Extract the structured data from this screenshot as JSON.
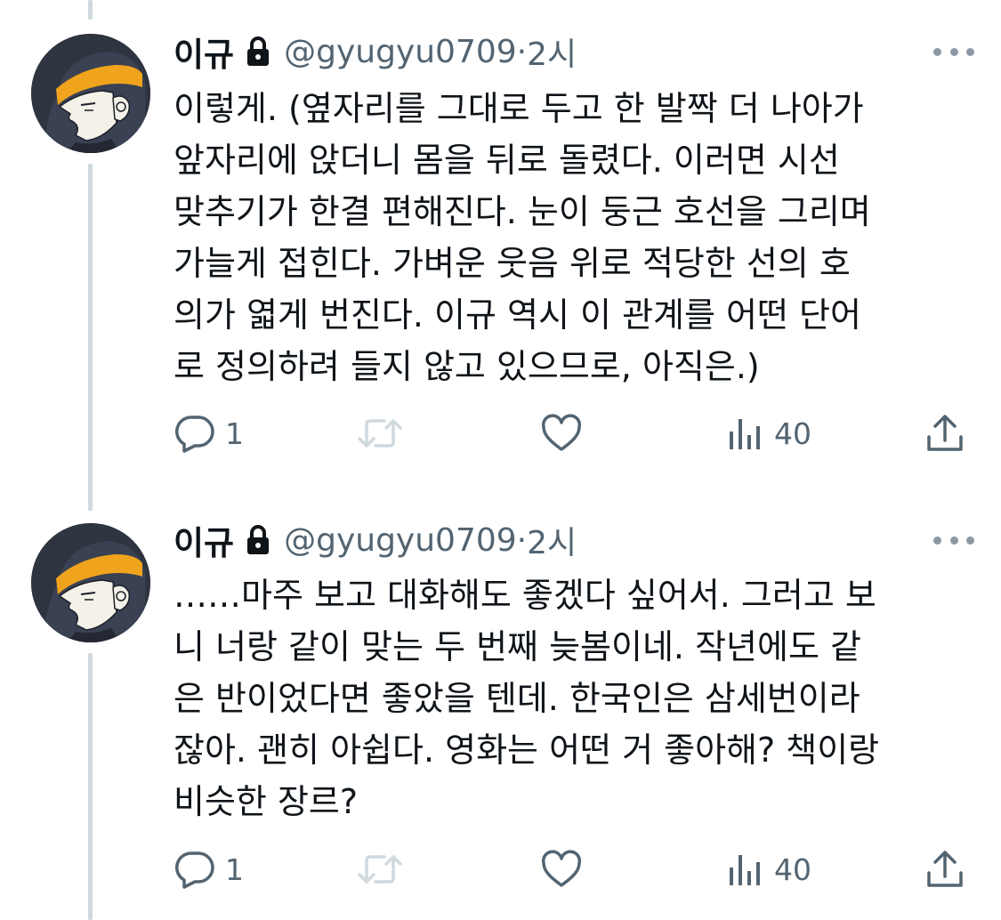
{
  "tweets": [
    {
      "author": {
        "name": "이규",
        "handle": "@gyugyu0709",
        "time": "2시"
      },
      "lines": [
        "이렇게. (옆자리를 그대로 두고 한 발짝 더 나아가",
        "앞자리에 앉더니 몸을 뒤로 돌렸다. 이러면 시선",
        "맞추기가 한결 편해진다. 눈이 둥근 호선을 그리며",
        "가늘게 접힌다. 가벼운 웃음 위로 적당한 선의 호",
        "의가 엷게 번진다. 이규 역시 이 관계를 어떤 단어",
        "로 정의하려 들지 않고 있으므로, 아직은.)"
      ],
      "stats": {
        "replies": "1",
        "views": "40"
      }
    },
    {
      "author": {
        "name": "이규",
        "handle": "@gyugyu0709",
        "time": "2시"
      },
      "lines": [
        "……마주 보고 대화해도 좋겠다 싶어서. 그러고 보",
        "니 너랑 같이 맞는 두 번째 늦봄이네. 작년에도 같",
        "은 반이었다면 좋았을 텐데. 한국인은 삼세번이라",
        "잖아. 괜히 아쉽다. 영화는 어떤 거 좋아해? 책이랑",
        "비슷한 장르?"
      ],
      "stats": {
        "replies": "1",
        "views": "40"
      }
    }
  ],
  "separator": " · ",
  "icons": {
    "lock": "lock-icon",
    "more": "more-icon",
    "reply": "reply-icon",
    "repost": "repost-icon",
    "like": "like-icon",
    "views": "views-icon",
    "share": "share-icon"
  },
  "colors": {
    "text": "#0f1419",
    "secondary": "#536471",
    "thread_line": "#cfd9de",
    "repost_disabled": "#cfd9de",
    "avatar_band": "#f0a31c"
  }
}
